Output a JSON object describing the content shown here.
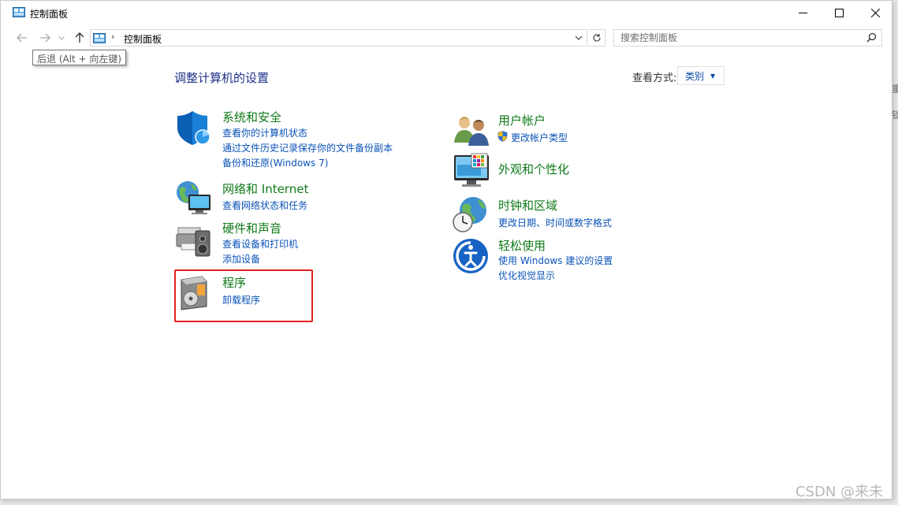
{
  "window": {
    "title": "控制面板",
    "app_icon": "control-panel-icon"
  },
  "titlebar_buttons": {
    "minimize": "minimize-icon",
    "maximize": "maximize-icon",
    "close": "close-icon"
  },
  "nav": {
    "back_icon": "arrow-left-icon",
    "forward_icon": "arrow-right-icon",
    "recent_icon": "chevron-down-icon",
    "up_icon": "arrow-up-icon",
    "separator": "›",
    "breadcrumb": "控制面板",
    "refresh_icon": "refresh-icon",
    "search_placeholder": "搜索控制面板",
    "search_icon": "search-icon"
  },
  "tooltip": "后退 (Alt + 向左键)",
  "main": {
    "heading": "调整计算机的设置",
    "view_by_label": "查看方式:",
    "view_by_value": "类别"
  },
  "categories": {
    "system": {
      "title": "系统和安全",
      "links": [
        "查看你的计算机状态",
        "通过文件历史记录保存你的文件备份副本",
        "备份和还原(Windows 7)"
      ],
      "icon": "shield-icon"
    },
    "network": {
      "title": "网络和 Internet",
      "links": [
        "查看网络状态和任务"
      ],
      "icon": "network-globe-icon"
    },
    "hardware": {
      "title": "硬件和声音",
      "links": [
        "查看设备和打印机",
        "添加设备"
      ],
      "icon": "printer-speaker-icon"
    },
    "programs": {
      "title": "程序",
      "links": [
        "卸载程序"
      ],
      "icon": "programs-disc-icon"
    },
    "users": {
      "title": "用户帐户",
      "links": [
        "更改帐户类型"
      ],
      "icon": "users-icon",
      "link_icon": "uac-shield-icon"
    },
    "appearance": {
      "title": "外观和个性化",
      "links": [],
      "icon": "monitor-palette-icon"
    },
    "clock": {
      "title": "时钟和区域",
      "links": [
        "更改日期、时间或数字格式"
      ],
      "icon": "clock-globe-icon"
    },
    "ease": {
      "title": "轻松使用",
      "links": [
        "使用 Windows 建议的设置",
        "优化视觉显示"
      ],
      "icon": "ease-of-access-icon"
    }
  },
  "colors": {
    "category_title": "#0f7a18",
    "link": "#0a53b8",
    "heading": "#1e3287",
    "highlight_box": "#e0231f"
  },
  "watermark": "CSDN @来未",
  "edge_text": [
    "重",
    "锁"
  ]
}
